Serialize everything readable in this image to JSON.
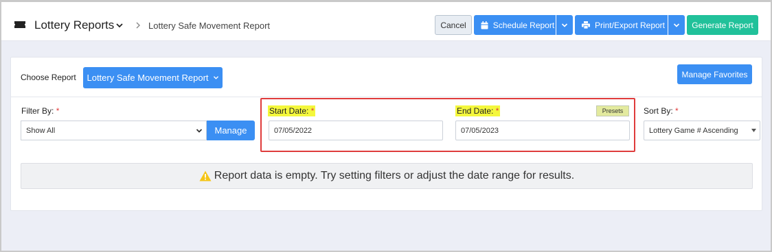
{
  "header": {
    "app_title": "Lottery Reports",
    "breadcrumb": "Lottery Safe Movement Report",
    "buttons": {
      "cancel": "Cancel",
      "schedule": "Schedule Report",
      "print_export": "Print/Export Report",
      "generate": "Generate Report"
    }
  },
  "report": {
    "choose_label": "Choose Report",
    "selected_report": "Lottery Safe Movement Report",
    "manage_favorites": "Manage Favorites"
  },
  "filters": {
    "filter_by_label": "Filter By:",
    "filter_value": "Show All",
    "manage_label": "Manage",
    "start_date_label": "Start Date:",
    "start_date_value": "07/05/2022",
    "end_date_label": "End Date:",
    "end_date_value": "07/05/2023",
    "presets_label": "Presets",
    "sort_by_label": "Sort By:",
    "sort_value": "Lottery Game # Ascending",
    "required_mark": "*"
  },
  "message": {
    "empty": "Report data is empty. Try setting filters or adjust the date range for results."
  },
  "colors": {
    "primary": "#3b8ff3",
    "success": "#21c19a",
    "highlight": "#f4f73c",
    "annotation": "#df3b3b",
    "required": "#e23a3a"
  }
}
